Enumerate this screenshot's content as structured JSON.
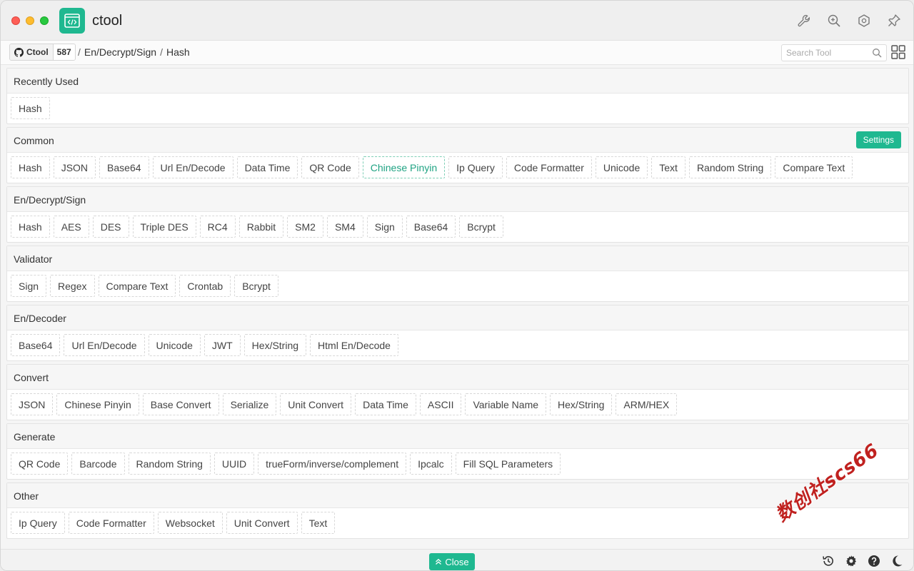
{
  "window": {
    "title": "ctool"
  },
  "colors": {
    "accent": "#1fb890",
    "active_text": "#1fa383"
  },
  "title_tools": [
    "wrench-icon",
    "zoom-in-icon",
    "hexagon-icon",
    "pin-icon"
  ],
  "navbar": {
    "github_label": "Ctool",
    "github_count": "587",
    "breadcrumb": [
      "En/Decrypt/Sign",
      "Hash"
    ],
    "search_placeholder": "Search Tool"
  },
  "sections": [
    {
      "title": "Recently Used",
      "items": [
        "Hash"
      ]
    },
    {
      "title": "Common",
      "settings_label": "Settings",
      "items": [
        "Hash",
        "JSON",
        "Base64",
        "Url En/Decode",
        "Data Time",
        "QR Code",
        "Chinese Pinyin",
        "Ip Query",
        "Code Formatter",
        "Unicode",
        "Text",
        "Random String",
        "Compare Text"
      ],
      "active": "Chinese Pinyin"
    },
    {
      "title": "En/Decrypt/Sign",
      "items": [
        "Hash",
        "AES",
        "DES",
        "Triple DES",
        "RC4",
        "Rabbit",
        "SM2",
        "SM4",
        "Sign",
        "Base64",
        "Bcrypt"
      ]
    },
    {
      "title": "Validator",
      "items": [
        "Sign",
        "Regex",
        "Compare Text",
        "Crontab",
        "Bcrypt"
      ]
    },
    {
      "title": "En/Decoder",
      "items": [
        "Base64",
        "Url En/Decode",
        "Unicode",
        "JWT",
        "Hex/String",
        "Html En/Decode"
      ]
    },
    {
      "title": "Convert",
      "items": [
        "JSON",
        "Chinese Pinyin",
        "Base Convert",
        "Serialize",
        "Unit Convert",
        "Data Time",
        "ASCII",
        "Variable Name",
        "Hex/String",
        "ARM/HEX"
      ]
    },
    {
      "title": "Generate",
      "items": [
        "QR Code",
        "Barcode",
        "Random String",
        "UUID",
        "trueForm/inverse/complement",
        "Ipcalc",
        "Fill SQL Parameters"
      ]
    },
    {
      "title": "Other",
      "items": [
        "Ip Query",
        "Code Formatter",
        "Websocket",
        "Unit Convert",
        "Text"
      ]
    }
  ],
  "footer": {
    "close_label": "Close",
    "icons": [
      "history-icon",
      "gear-icon",
      "help-icon",
      "moon-icon"
    ]
  },
  "watermark": "数创社scs66"
}
